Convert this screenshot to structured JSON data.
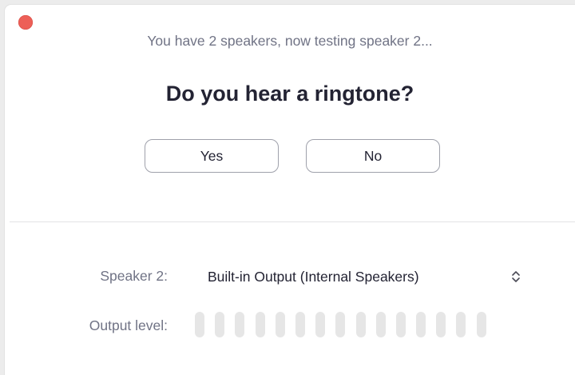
{
  "dialog": {
    "subtitle": "You have 2 speakers, now testing speaker 2...",
    "question": "Do you hear a ringtone?",
    "yes_label": "Yes",
    "no_label": "No"
  },
  "speaker": {
    "label": "Speaker 2:",
    "selected_value": "Built-in Output (Internal Speakers)",
    "selector_icon": "chevron-up-down-icon"
  },
  "output_level": {
    "label": "Output level:",
    "segments_total": 15,
    "segments_active": 0
  },
  "colors": {
    "close_button": "#ed5f57",
    "title_text": "#232333",
    "secondary_text": "#707385",
    "meter_inactive": "#e6e6e6"
  }
}
